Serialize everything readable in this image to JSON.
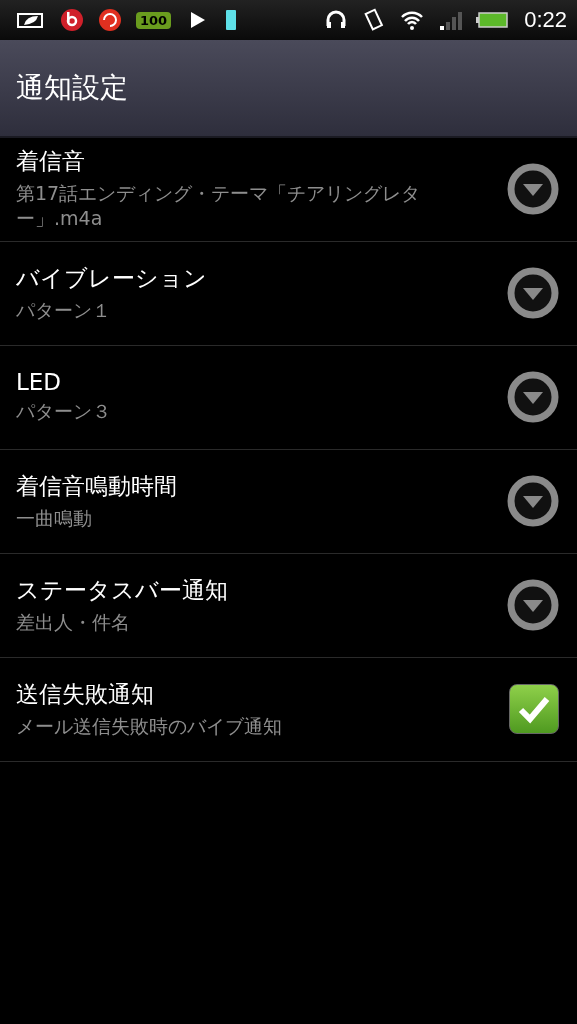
{
  "status_bar": {
    "battery_badge": "100",
    "time": "0:22"
  },
  "header": {
    "title": "通知設定"
  },
  "settings": [
    {
      "kind": "dropdown",
      "title": "着信音",
      "summary": "第17話エンディング・テーマ「チアリングレター」.m4a"
    },
    {
      "kind": "dropdown",
      "title": "バイブレーション",
      "summary": "パターン１"
    },
    {
      "kind": "dropdown",
      "title": "LED",
      "summary": "パターン３"
    },
    {
      "kind": "dropdown",
      "title": "着信音鳴動時間",
      "summary": "一曲鳴動"
    },
    {
      "kind": "dropdown",
      "title": "ステータスバー通知",
      "summary": "差出人・件名"
    },
    {
      "kind": "checkbox",
      "title": "送信失敗通知",
      "summary": "メール送信失敗時のバイブ通知",
      "checked": true
    }
  ]
}
